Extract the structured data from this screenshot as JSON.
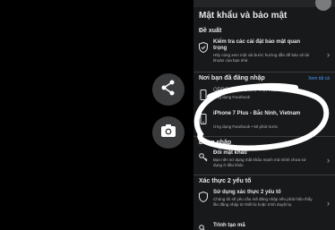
{
  "actions": {
    "share_icon": "share-icon",
    "camera_icon": "camera-icon"
  },
  "settings": {
    "title": "Mật khẩu và bảo mật",
    "suggested": {
      "header": "Đề xuất",
      "item": {
        "title": "Kiểm tra các cài đặt bảo mật quan trọng",
        "subtitle": "Hãy cùng xem một vài bước hướng dẫn để bảo vệ tài khoản của bạn nhé."
      }
    },
    "logins": {
      "header": "Nơi bạn đã đăng nhập",
      "see_all": "Xem tất cả",
      "devices": [
        {
          "name": "OPPO A15 - Biên, Việt Nam",
          "detail": "Ứng dụng Facebook"
        },
        {
          "name": "iPhone 7 Plus - Bắc Ninh, Vietnam",
          "detail": "Ứng dụng Facebook • 50 phút trước"
        }
      ]
    },
    "login": {
      "header": "Đăng nhập",
      "change_password": {
        "title": "Đổi mật khẩu",
        "subtitle": "Bạn nên sử dụng mật khẩu mạnh mà mình chưa sử dụng ở đâu khác"
      }
    },
    "two_factor": {
      "header": "Xác thực 2 yếu tố",
      "item": {
        "title": "Sử dụng xác thực 2 yếu tố",
        "subtitle": "Chúng tôi sẽ yêu cầu mã đăng nhập nếu phát hiện thấy lần đăng nhập từ thiết bị hoặc trình duyệt lạ."
      }
    },
    "bottom": {
      "title": "Trình tạo mã"
    }
  },
  "colors": {
    "panel_bg": "#18191a",
    "accent_link": "#4599ff",
    "text_primary": "#e4e6eb",
    "text_secondary": "#b0b3b8",
    "scribble": "#ffffff"
  }
}
